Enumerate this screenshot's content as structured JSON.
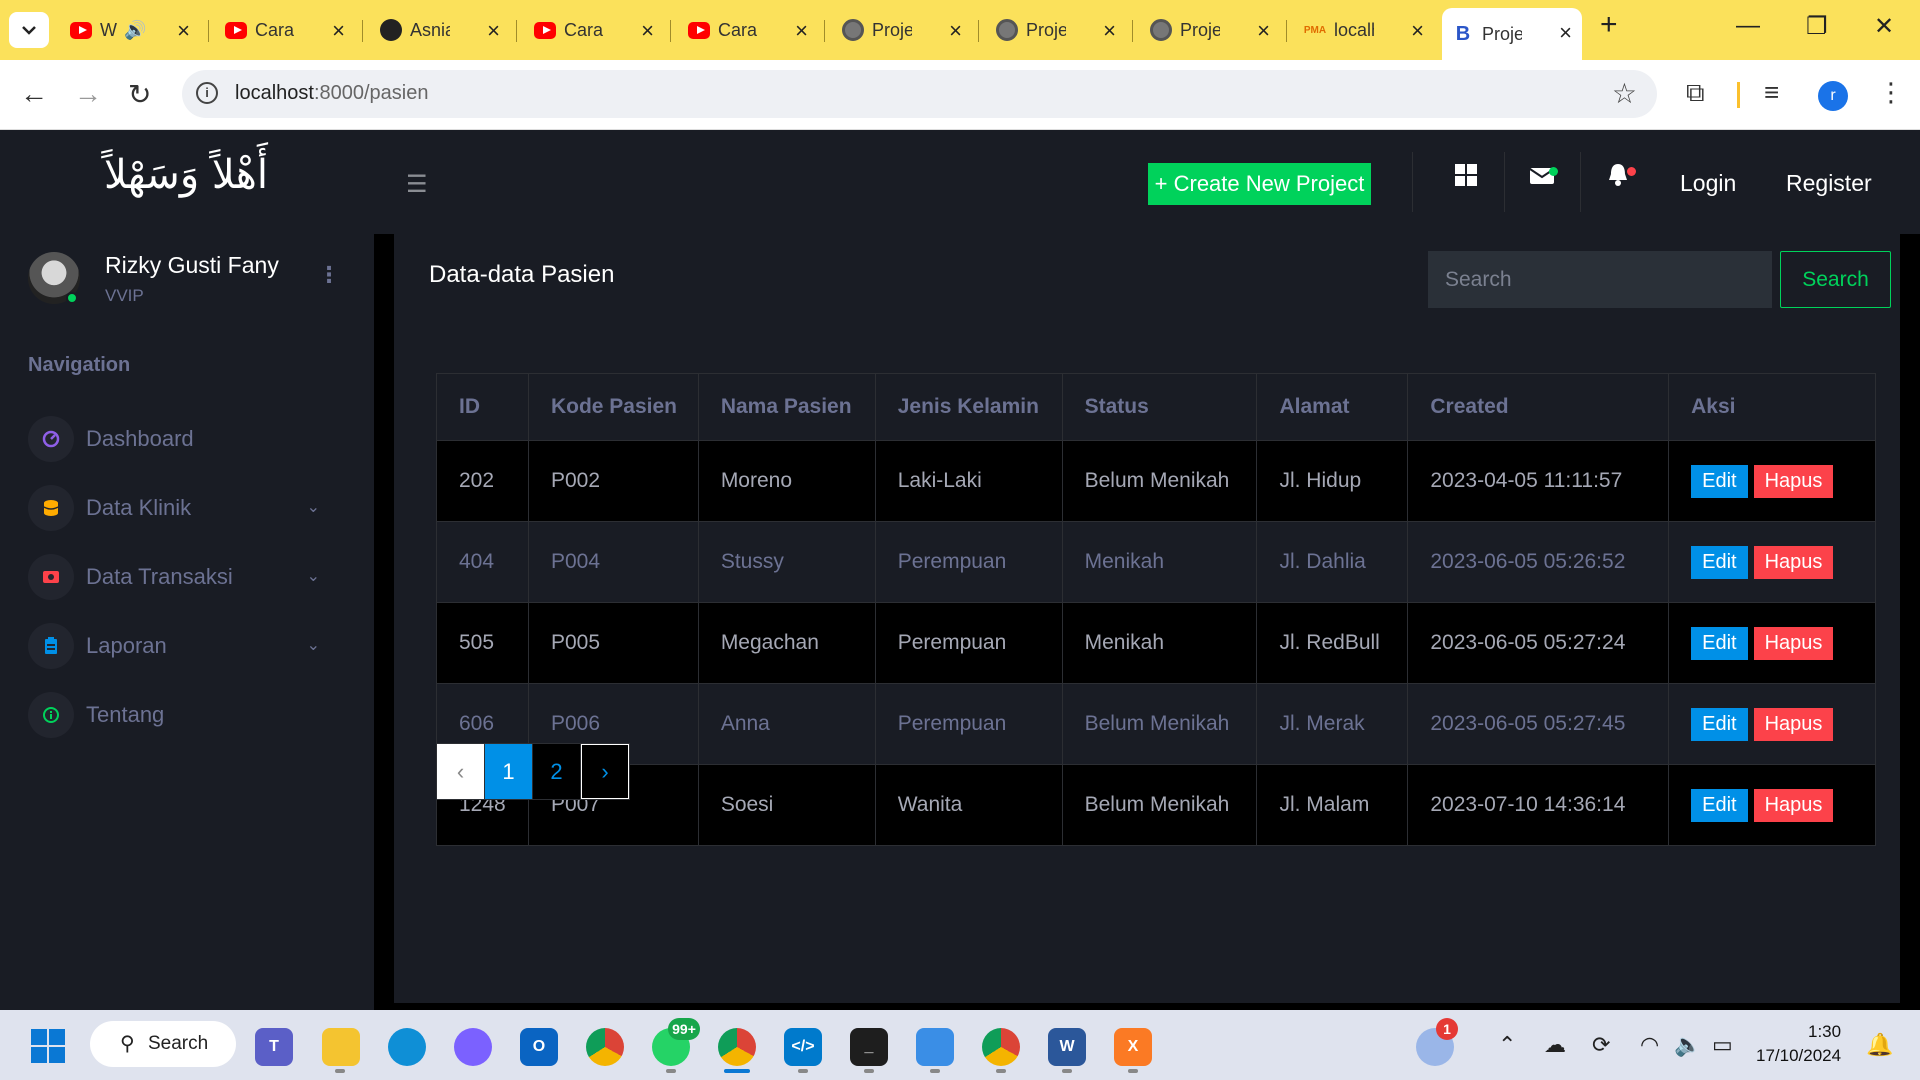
{
  "browser": {
    "tabs": [
      {
        "label": "W",
        "icon": "youtube-icon"
      },
      {
        "label": "Cara U",
        "icon": "youtube-icon"
      },
      {
        "label": "Asnial",
        "icon": "github-icon"
      },
      {
        "label": "Cara C",
        "icon": "youtube-icon"
      },
      {
        "label": "Cara U",
        "icon": "youtube-icon"
      },
      {
        "label": "Projec",
        "icon": "globe-icon"
      },
      {
        "label": "Projec",
        "icon": "globe-icon"
      },
      {
        "label": "Projec",
        "icon": "globe-icon"
      },
      {
        "label": "localh",
        "icon": "phpmyadmin-icon"
      },
      {
        "label": "Projec",
        "icon": "bootstrap-icon",
        "active": true
      }
    ],
    "pma_text": "PMA",
    "bs_text": "B",
    "url_host": "localhost",
    "url_path": ":8000/pasien",
    "profile_initial": "r"
  },
  "app": {
    "brand": "أَهْلاً وَسَهْلاً",
    "user": {
      "name": "Rizky Gusti Fany",
      "role": "VVIP"
    },
    "nav_title": "Navigation",
    "nav_items": [
      {
        "label": "Dashboard",
        "icon": "speedometer-icon",
        "color": "#8f5fe8"
      },
      {
        "label": "Data Klinik",
        "icon": "database-icon",
        "color": "#ffab00",
        "expandable": true
      },
      {
        "label": "Data Transaksi",
        "icon": "cash-icon",
        "color": "#fc424a",
        "expandable": true
      },
      {
        "label": "Laporan",
        "icon": "clipboard-icon",
        "color": "#0090e7",
        "expandable": true
      },
      {
        "label": "Tentang",
        "icon": "info-icon",
        "color": "#00d25b"
      }
    ],
    "topnav": {
      "create_label": "+ Create New Project",
      "login": "Login",
      "register": "Register"
    },
    "page": {
      "heading": "Data-data Pasien",
      "search_placeholder": "Search",
      "search_button": "Search"
    },
    "table": {
      "headers": [
        "ID",
        "Kode Pasien",
        "Nama Pasien",
        "Jenis Kelamin",
        "Status",
        "Alamat",
        "Created",
        "Aksi"
      ],
      "rows": [
        [
          "202",
          "P002",
          "Moreno",
          "Laki-Laki",
          "Belum Menikah",
          "Jl. Hidup",
          "2023-04-05 11:11:57"
        ],
        [
          "404",
          "P004",
          "Stussy",
          "Perempuan",
          "Menikah",
          "Jl. Dahlia",
          "2023-06-05 05:26:52"
        ],
        [
          "505",
          "P005",
          "Megachan",
          "Perempuan",
          "Menikah",
          "Jl. RedBull",
          "2023-06-05 05:27:24"
        ],
        [
          "606",
          "P006",
          "Anna",
          "Perempuan",
          "Belum Menikah",
          "Jl. Merak",
          "2023-06-05 05:27:45"
        ],
        [
          "1248",
          "P007",
          "Soesi",
          "Wanita",
          "Belum Menikah",
          "Jl. Malam",
          "2023-07-10 14:36:14"
        ]
      ],
      "edit_label": "Edit",
      "delete_label": "Hapus"
    },
    "pagination": {
      "prev": "‹",
      "pages": [
        "1",
        "2"
      ],
      "current": "1",
      "next": "›"
    }
  },
  "taskbar": {
    "search_label": "Search",
    "whatsapp_badge": "99+",
    "weather_badge": "1",
    "time": "1:30",
    "date": "17/10/2024"
  },
  "colors": {
    "accent_green": "#00d25b",
    "accent_blue": "#0090e7",
    "accent_red": "#fc424a",
    "bg_dark": "#191c24",
    "tab_bar": "#fbe15b"
  }
}
